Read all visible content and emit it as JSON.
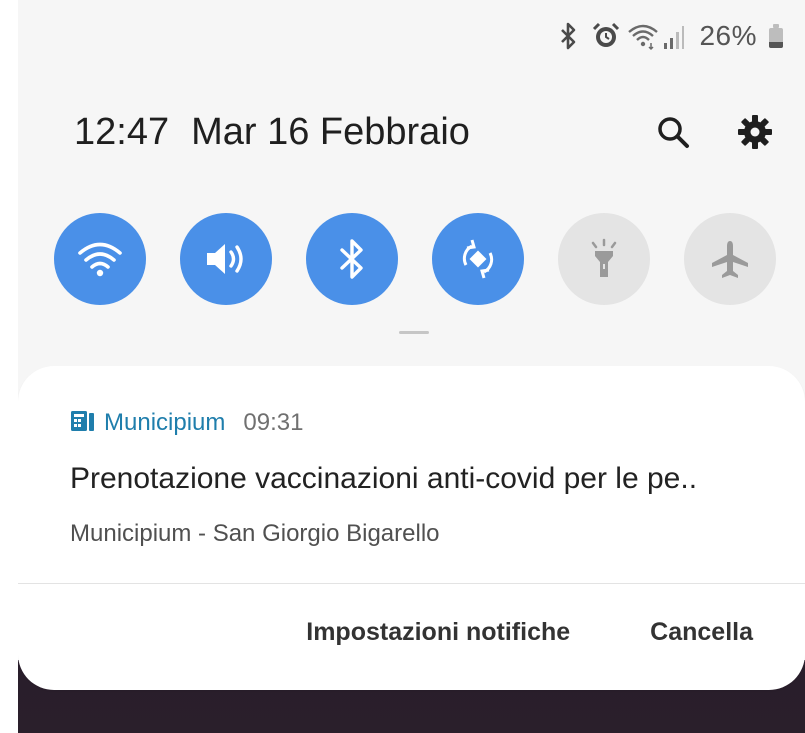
{
  "status_bar": {
    "icons": [
      "bluetooth-icon",
      "alarm-icon",
      "wifi-icon",
      "signal-icon"
    ],
    "battery_percent": "26%",
    "battery_level": 0.26
  },
  "header": {
    "time": "12:47",
    "date": "Mar 16 Febbraio",
    "search_icon": "search-icon",
    "settings_icon": "gear-icon"
  },
  "quick_settings": [
    {
      "name": "wifi",
      "icon": "wifi-icon",
      "state": "on"
    },
    {
      "name": "sound",
      "icon": "speaker-icon",
      "state": "on"
    },
    {
      "name": "bluetooth",
      "icon": "bluetooth-icon",
      "state": "on"
    },
    {
      "name": "auto-rotate",
      "icon": "rotate-icon",
      "state": "on"
    },
    {
      "name": "flashlight",
      "icon": "flashlight-icon",
      "state": "off"
    },
    {
      "name": "airplane",
      "icon": "airplane-icon",
      "state": "off"
    }
  ],
  "notification": {
    "app_name": "Municipium",
    "time": "09:31",
    "title": "Prenotazione vaccinazioni anti-covid per le pe..",
    "subtitle": "Municipium - San Giorgio Bigarello",
    "actions": {
      "settings": "Impostazioni notifiche",
      "clear": "Cancella"
    }
  },
  "colors": {
    "accent": "#4a90e8",
    "tile_off": "#e4e4e4",
    "app_name": "#1f7eac"
  }
}
